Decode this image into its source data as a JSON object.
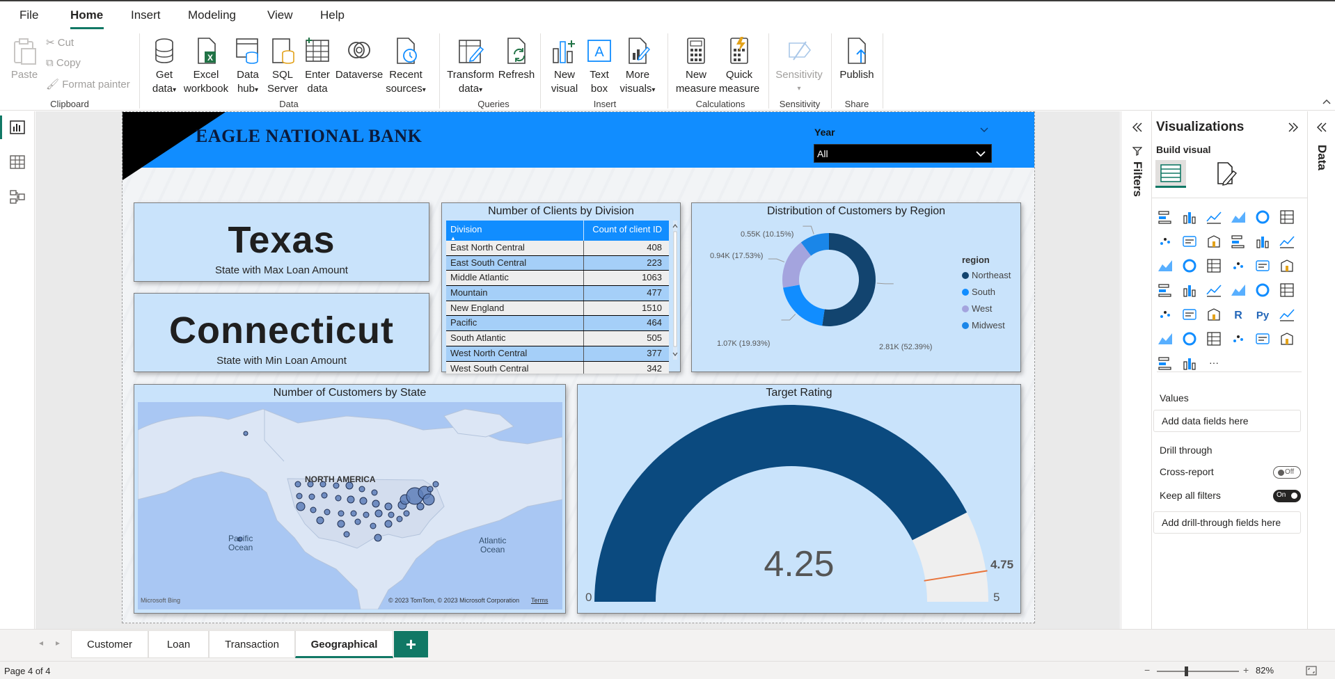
{
  "menu": {
    "items": [
      {
        "label": "File",
        "active": false
      },
      {
        "label": "Home",
        "active": true
      },
      {
        "label": "Insert",
        "active": false
      },
      {
        "label": "Modeling",
        "active": false
      },
      {
        "label": "View",
        "active": false
      },
      {
        "label": "Help",
        "active": false
      }
    ]
  },
  "ribbon": {
    "clipboard": {
      "paste": "Paste",
      "cut": "Cut",
      "copy": "Copy",
      "format_painter": "Format painter",
      "group": "Clipboard"
    },
    "data": {
      "get_data_1": "Get",
      "get_data_2": "data",
      "excel_1": "Excel",
      "excel_2": "workbook",
      "hub_1": "Data",
      "hub_2": "hub",
      "sql_1": "SQL",
      "sql_2": "Server",
      "enter_1": "Enter",
      "enter_2": "data",
      "dataverse": "Dataverse",
      "recent_1": "Recent",
      "recent_2": "sources",
      "group": "Data"
    },
    "queries": {
      "transform_1": "Transform",
      "transform_2": "data",
      "refresh": "Refresh",
      "group": "Queries"
    },
    "insert": {
      "new_visual_1": "New",
      "new_visual_2": "visual",
      "text_box_1": "Text",
      "text_box_2": "box",
      "more_1": "More",
      "more_2": "visuals",
      "group": "Insert"
    },
    "calculations": {
      "new_measure_1": "New",
      "new_measure_2": "measure",
      "quick_measure_1": "Quick",
      "quick_measure_2": "measure",
      "group": "Calculations"
    },
    "sensitivity": {
      "label": "Sensitivity",
      "group": "Sensitivity"
    },
    "share": {
      "publish": "Publish",
      "group": "Share"
    }
  },
  "report": {
    "title": "EAGLE NATIONAL BANK",
    "year_filter": {
      "label": "Year",
      "value": "All"
    },
    "kpi_max": {
      "value": "Texas",
      "caption": "State with Max Loan Amount"
    },
    "kpi_min": {
      "value": "Connecticut",
      "caption": "State with Min Loan Amount"
    },
    "clients_table": {
      "title": "Number of Clients by Division",
      "headers": [
        "Division",
        "Count of client ID"
      ],
      "rows": [
        [
          "East North Central",
          "408"
        ],
        [
          "East South Central",
          "223"
        ],
        [
          "Middle Atlantic",
          "1063"
        ],
        [
          "Mountain",
          "477"
        ],
        [
          "New England",
          "1510"
        ],
        [
          "Pacific",
          "464"
        ],
        [
          "South Atlantic",
          "505"
        ],
        [
          "West North Central",
          "377"
        ],
        [
          "West South Central",
          "342"
        ]
      ]
    },
    "map": {
      "title": "Number of Customers by State",
      "labels": {
        "continent": "NORTH AMERICA",
        "pacific_1": "Pacific",
        "pacific_2": "Ocean",
        "atlantic_1": "Atlantic",
        "atlantic_2": "Ocean"
      },
      "credit": "© 2023 TomTom, © 2023 Microsoft Corporation",
      "terms": "Terms",
      "bing": "Microsoft Bing"
    },
    "gauge": {
      "title": "Target Rating",
      "value_label": "4.25",
      "min_label": "0",
      "max_label": "5",
      "target_label": "4.75"
    }
  },
  "chart_data": [
    {
      "type": "pie",
      "title": "Distribution of Customers by Region",
      "legend_title": "region",
      "legend_position": "right",
      "categories": [
        "Northeast",
        "South",
        "West",
        "Midwest"
      ],
      "values": [
        2.81,
        1.07,
        0.94,
        0.55
      ],
      "labels": [
        "2.81K (52.39%)",
        "1.07K (19.93%)",
        "0.94K (17.53%)",
        "0.55K (10.15%)"
      ],
      "percents": [
        52.39,
        19.93,
        17.53,
        10.15
      ],
      "colors": [
        "#12446f",
        "#118dff",
        "#a4a4de",
        "#1a86e8"
      ]
    },
    {
      "type": "gauge",
      "title": "Target Rating",
      "value": 4.25,
      "min": 0,
      "max": 5,
      "target": 4.75,
      "colors": {
        "fill": "#0b4a7f",
        "track": "#efefef",
        "target": "#e8743b"
      }
    }
  ],
  "panes": {
    "filters": "Filters",
    "visualizations": "Visualizations",
    "build_visual": "Build visual",
    "values": "Values",
    "add_data_fields": "Add data fields here",
    "drill_through": "Drill through",
    "cross_report": "Cross-report",
    "cross_report_state": "Off",
    "keep_all_filters": "Keep all filters",
    "keep_all_filters_state": "On",
    "add_drill_fields": "Add drill-through fields here",
    "data": "Data",
    "viz_icons": [
      "stacked-bar",
      "stacked-column",
      "clustered-bar",
      "clustered-column",
      "100-bar",
      "100-column",
      "line",
      "area",
      "stacked-area",
      "line-column",
      "line-clustered",
      "ribbon",
      "waterfall",
      "funnel",
      "scatter",
      "pie",
      "donut",
      "treemap",
      "map",
      "filled-map",
      "gauge",
      "card",
      "multi-row-card",
      "kpi",
      "slicer",
      "table",
      "matrix",
      "r-visual",
      "python-visual",
      "key-influencers",
      "decomp-tree",
      "qa",
      "paginated",
      "smart-narrative",
      "metrics",
      "arcgis",
      "power-apps",
      "power-automate",
      "more"
    ]
  },
  "tabs": {
    "items": [
      "Customer",
      "Loan",
      "Transaction",
      "Geographical"
    ],
    "active": "Geographical",
    "add": "+"
  },
  "status": {
    "page": "Page 4 of 4",
    "zoom": "82%"
  }
}
